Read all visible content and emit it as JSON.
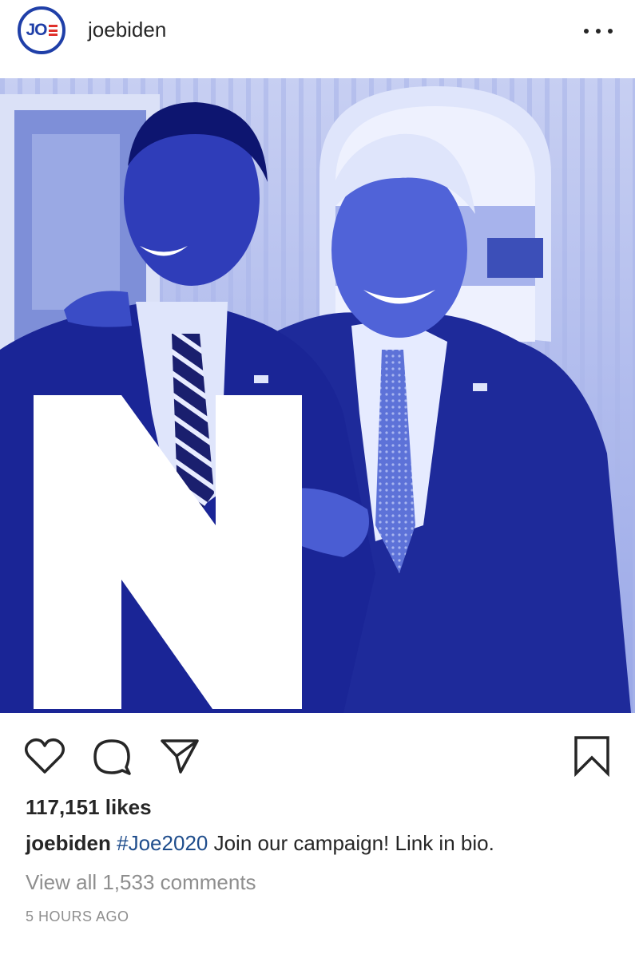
{
  "post": {
    "account": {
      "username": "joebiden",
      "avatar_text": "JO"
    },
    "image_overlay_letter": "N",
    "actions": {
      "like_icon": "heart-icon",
      "comment_icon": "comment-icon",
      "share_icon": "paper-plane-icon",
      "save_icon": "bookmark-icon"
    },
    "likes": "117,151 likes",
    "caption": {
      "username": "joebiden",
      "hashtag": "#Joe2020",
      "text": " Join our campaign! Link in bio."
    },
    "view_comments": "View all 1,533 comments",
    "timestamp": "5 HOURS AGO"
  },
  "colors": {
    "brand_blue": "#1f3fa8",
    "brand_red": "#e0312b",
    "photo_tint": "#2a3fc7",
    "text": "#262626",
    "muted": "#8e8e8e"
  }
}
